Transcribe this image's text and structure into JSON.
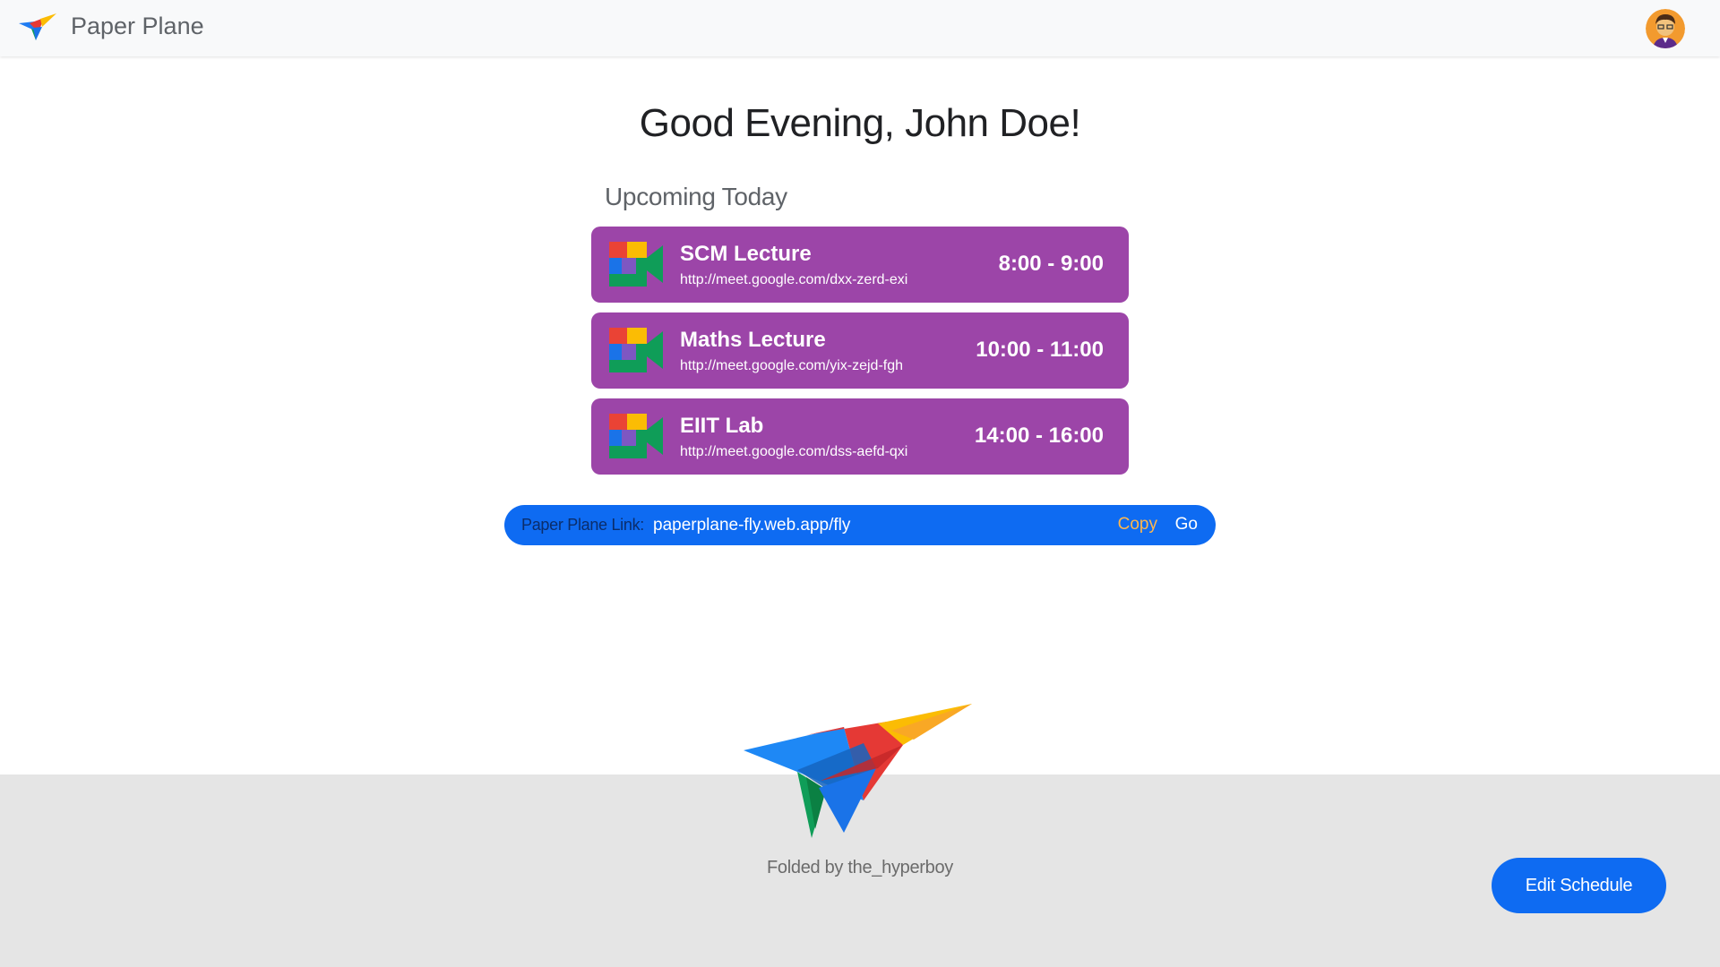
{
  "header": {
    "app_name": "Paper Plane",
    "logo_icon": "paper-plane-logo-icon",
    "avatar_icon": "user-avatar-icon"
  },
  "main": {
    "greeting": "Good Evening, John Doe!",
    "section_title": "Upcoming Today",
    "events": [
      {
        "name": "SCM Lecture",
        "link": "http://meet.google.com/dxx-zerd-exi",
        "time": "8:00 - 9:00",
        "icon": "google-meet-icon"
      },
      {
        "name": "Maths Lecture",
        "link": "http://meet.google.com/yix-zejd-fgh",
        "time": "10:00 - 11:00",
        "icon": "google-meet-icon"
      },
      {
        "name": "EIIT Lab",
        "link": "http://meet.google.com/dss-aefd-qxi",
        "time": "14:00 - 16:00",
        "icon": "google-meet-icon"
      }
    ],
    "link_bar": {
      "label": "Paper Plane Link:",
      "url": "paperplane-fly.web.app/fly",
      "copy_label": "Copy",
      "go_label": "Go"
    }
  },
  "footer": {
    "credit": "Folded by the_hyperboy",
    "edit_label": "Edit Schedule",
    "plane_icon": "paper-plane-illustration"
  },
  "colors": {
    "event_card": "#9c45a8",
    "primary_blue": "#0e6bf2",
    "copy_orange": "#ffb74d",
    "footer_bg": "#e5e5e5",
    "header_bg": "#f8f9fa"
  }
}
